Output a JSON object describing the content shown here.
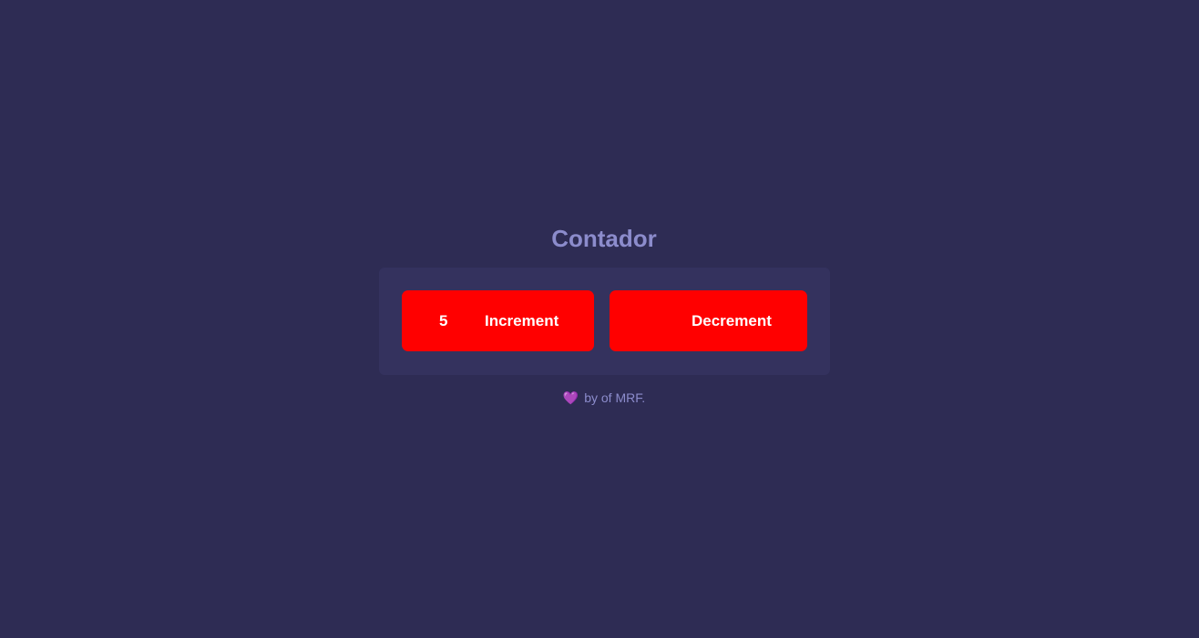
{
  "header": {
    "title": "Contador"
  },
  "counter": {
    "value": "5",
    "increment_label": "Increment",
    "decrement_label": "Decrement"
  },
  "footer": {
    "icon": "heart-icon",
    "text": "by of MRF."
  },
  "colors": {
    "background": "#2e2c54",
    "panel": "#34325e",
    "button": "#ff0000",
    "title": "#8c8ccc",
    "heart": "#a04bd0"
  }
}
